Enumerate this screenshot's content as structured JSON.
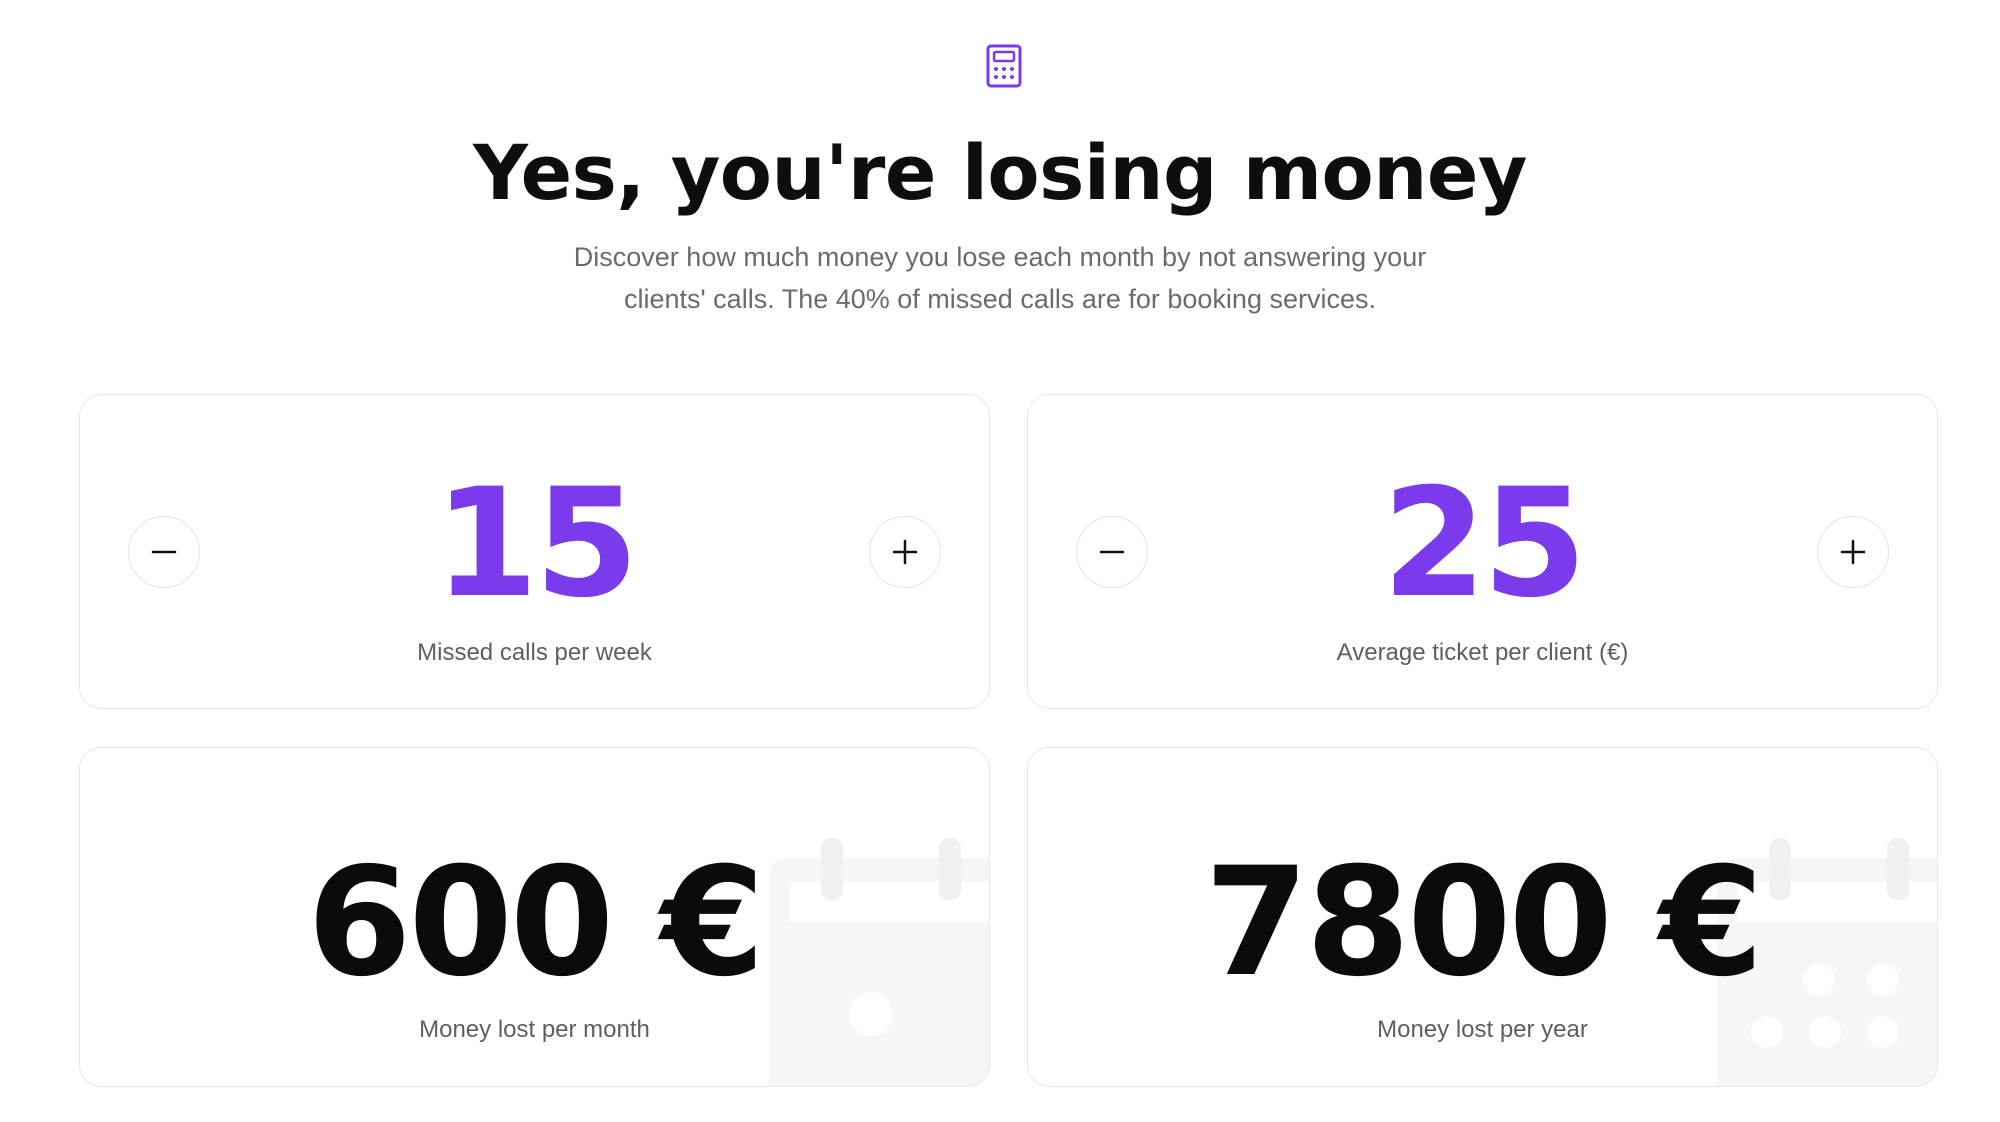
{
  "header": {
    "icon": "calculator-icon",
    "title": "Yes, you're losing money",
    "subtitle": "Discover how much money you lose each month by not answering your clients' calls. The 40% of missed calls are for booking services."
  },
  "inputs": {
    "missed_calls": {
      "value": "15",
      "label": "Missed calls per week"
    },
    "average_ticket": {
      "value": "25",
      "label": "Average ticket per client (€)"
    }
  },
  "results": {
    "monthly": {
      "value": "600 €",
      "label": "Money lost per month",
      "icon": "calendar-icon"
    },
    "yearly": {
      "value": "7800 €",
      "label": "Money lost per year",
      "icon": "calendar-icon"
    }
  },
  "colors": {
    "accent": "#7c3aed",
    "text": "#0e0e0e",
    "muted": "#6b6b6b",
    "border": "#e6e6e6",
    "decoration": "#f6f6f6"
  }
}
